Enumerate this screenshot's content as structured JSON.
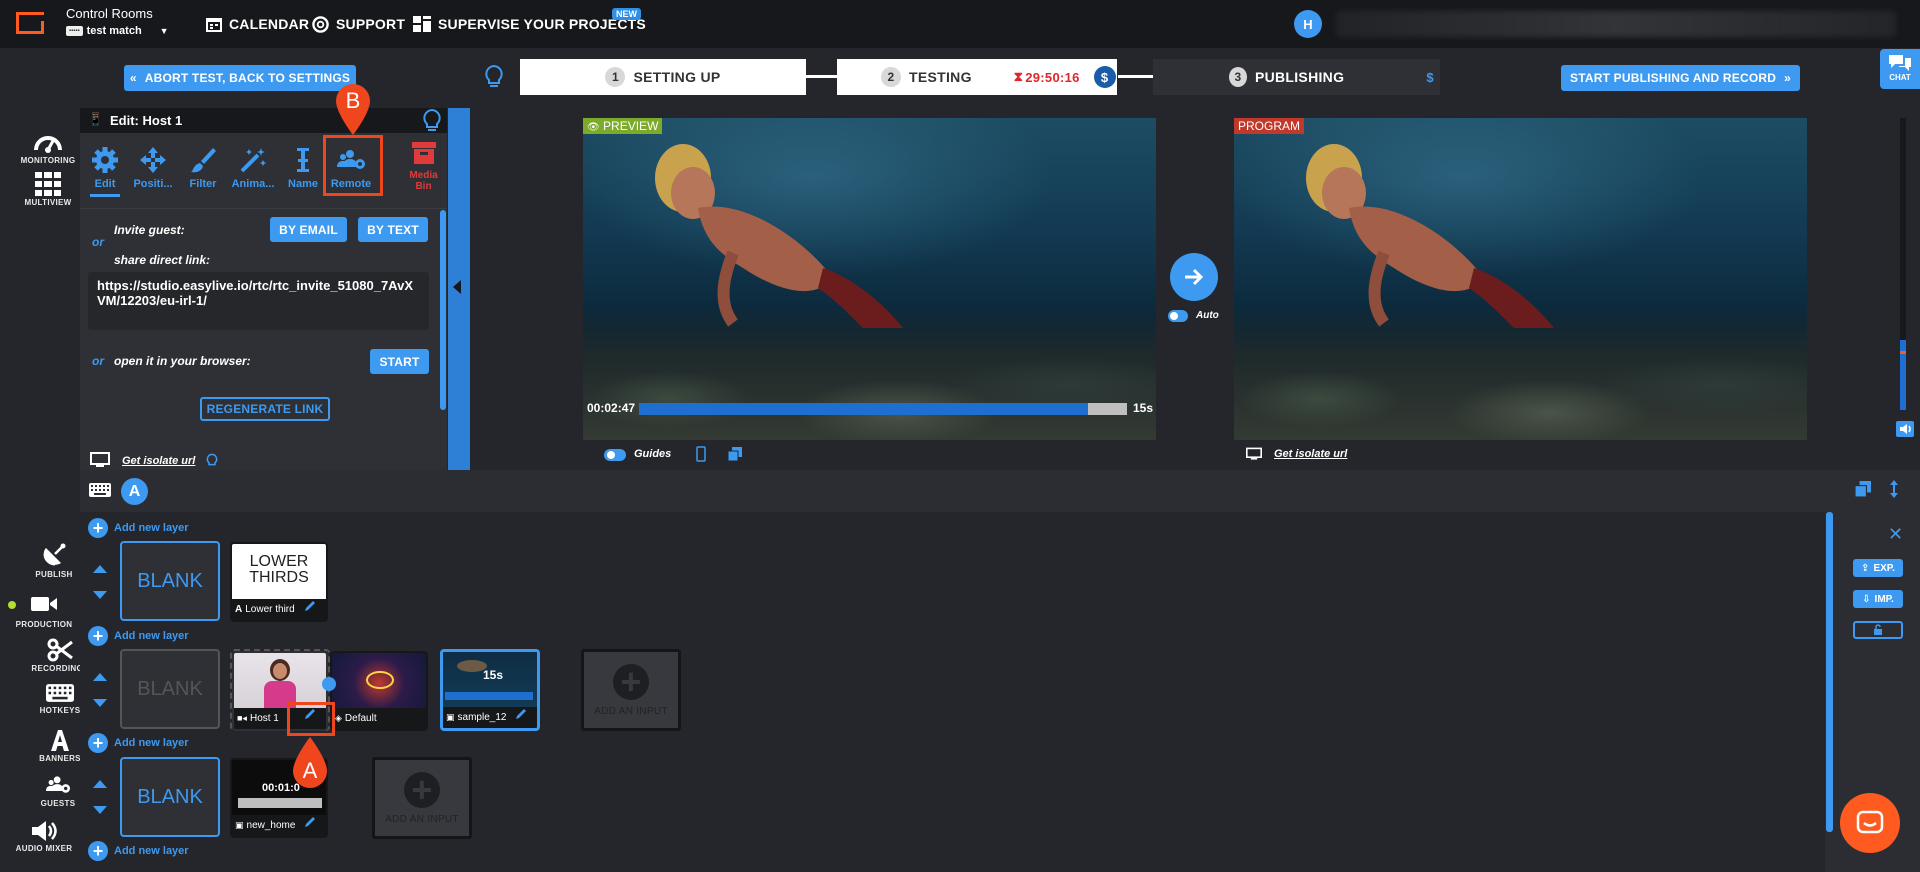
{
  "app": {
    "title": "Control Rooms",
    "project": "test match",
    "brand_color": "#ff5a1f",
    "accent_color": "#3d9af0"
  },
  "topnav": {
    "calendar": "CALENDAR",
    "support": "SUPPORT",
    "supervise": "SUPERVISE YOUR PROJECTS",
    "new_badge": "NEW",
    "user_initial": "H"
  },
  "toolbar": {
    "abort": "ABORT TEST, BACK TO SETTINGS",
    "start_publishing": "START PUBLISHING AND RECORD",
    "chat": "CHAT"
  },
  "steps": [
    {
      "num": "1",
      "label": "SETTING UP"
    },
    {
      "num": "2",
      "label": "TESTING",
      "timer": "29:50:16",
      "price": "$"
    },
    {
      "num": "3",
      "label": "PUBLISHING",
      "price": "$"
    }
  ],
  "sidenav_top": [
    {
      "label": "MONITORING",
      "icon": "speedometer-icon"
    },
    {
      "label": "MULTIVIEW",
      "icon": "grid-icon"
    }
  ],
  "sidenav_bottom": [
    {
      "label": "PUBLISH",
      "icon": "satellite-icon"
    },
    {
      "label": "PRODUCTION",
      "icon": "video-camera-icon"
    },
    {
      "label": "RECORDINGS",
      "icon": "scissors-icon"
    },
    {
      "label": "HOTKEYS",
      "icon": "keyboard-icon"
    },
    {
      "label": "BANNERS",
      "icon": "letter-a-icon"
    },
    {
      "label": "GUESTS",
      "icon": "users-icon"
    },
    {
      "label": "AUDIO MIXER",
      "icon": "speaker-icon"
    }
  ],
  "edit_panel": {
    "title": "Edit: Host 1",
    "tools": [
      "Edit",
      "Positi...",
      "Filter",
      "Anima...",
      "Name",
      "Remote"
    ],
    "media_bin": [
      "Media",
      "Bin"
    ],
    "invite_label": "Invite guest:",
    "by_email": "BY EMAIL",
    "by_text": "BY TEXT",
    "or": "or",
    "share_label": "share direct link:",
    "link": "https://studio.easylive.io/rtc/rtc_invite_51080_7AvXVM/12203/eu-irl-1/",
    "open_label": "open it in your browser:",
    "start": "START",
    "regenerate": "REGENERATE LINK",
    "isolate": "Get isolate url"
  },
  "preview": {
    "tag": "PREVIEW",
    "time": "00:02:47",
    "remaining": "15s",
    "progress": 0.92,
    "guides": "Guides"
  },
  "program": {
    "tag": "PROGRAM",
    "isolate": "Get isolate url"
  },
  "transition": {
    "auto": "Auto"
  },
  "scene_tab": "A",
  "layers": {
    "add_layer": "Add new layer",
    "blank": "BLANK",
    "add_input": "ADD AN INPUT",
    "row1": [
      {
        "name": "Lower third",
        "image_text": [
          "LOWER",
          "THIRDS"
        ]
      }
    ],
    "row2": [
      {
        "name": "Host 1"
      },
      {
        "name": "Default"
      },
      {
        "name": "sample_12",
        "badge": "15s"
      }
    ],
    "row3": [
      {
        "name": "new_home",
        "badge": "00:01:0"
      }
    ]
  },
  "right_panel": {
    "exp": "EXP.",
    "imp": "IMP."
  },
  "markers": {
    "a": "A",
    "b": "B",
    "color": "#f0461e"
  }
}
